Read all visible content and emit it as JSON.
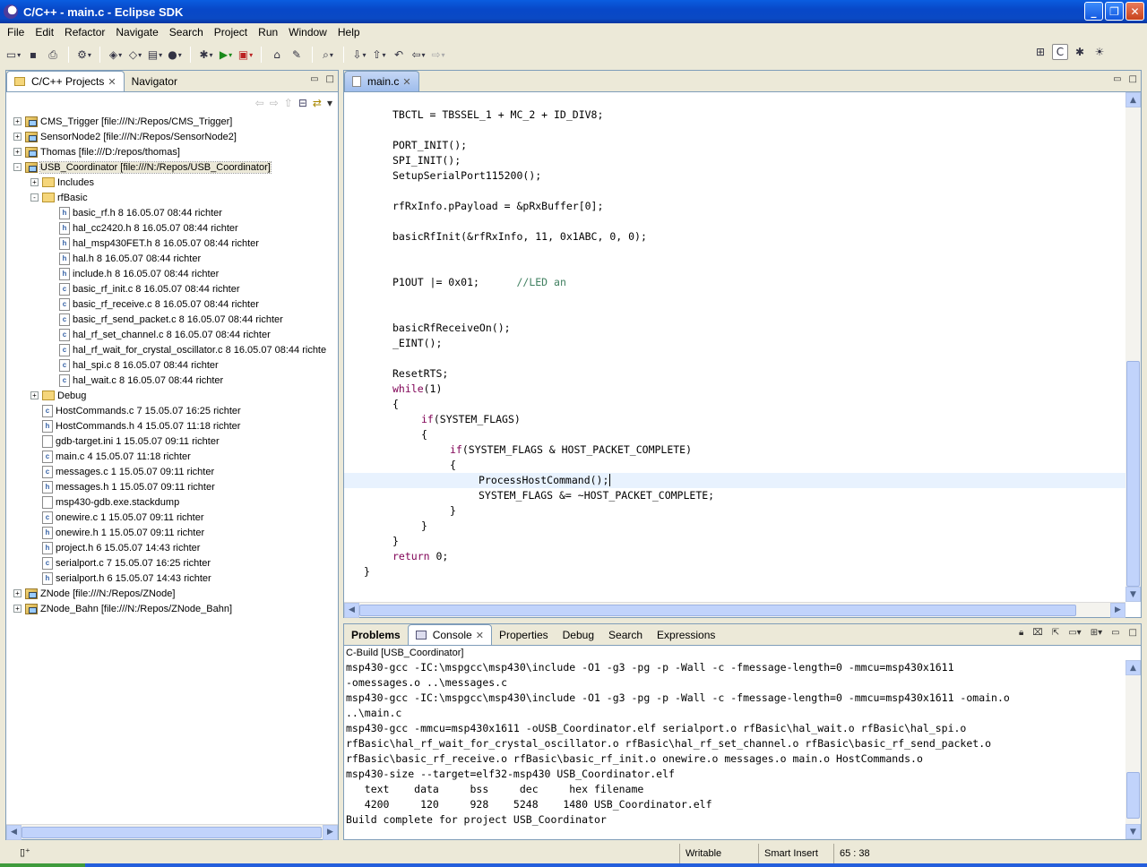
{
  "window": {
    "title": "C/C++ - main.c - Eclipse SDK"
  },
  "menu": [
    "File",
    "Edit",
    "Refactor",
    "Navigate",
    "Search",
    "Project",
    "Run",
    "Window",
    "Help"
  ],
  "left_panel": {
    "tabs": [
      {
        "label": "C/C++ Projects"
      },
      {
        "label": "Navigator"
      }
    ],
    "tree": [
      {
        "level": 0,
        "exp": "+",
        "type": "project",
        "label": "CMS_Trigger [file:///N:/Repos/CMS_Trigger]"
      },
      {
        "level": 0,
        "exp": "+",
        "type": "project",
        "label": "SensorNode2 [file:///N:/Repos/SensorNode2]"
      },
      {
        "level": 0,
        "exp": "+",
        "type": "project",
        "label": "Thomas [file:///D:/repos/thomas]"
      },
      {
        "level": 0,
        "exp": "-",
        "type": "project",
        "label": "USB_Coordinator [file:///N:/Repos/USB_Coordinator]",
        "selected": true
      },
      {
        "level": 1,
        "exp": "+",
        "type": "folder",
        "label": "Includes"
      },
      {
        "level": 1,
        "exp": "-",
        "type": "folder",
        "label": "rfBasic"
      },
      {
        "level": 2,
        "exp": "",
        "type": "file-h",
        "label": "basic_rf.h 8  16.05.07 08:44  richter"
      },
      {
        "level": 2,
        "exp": "",
        "type": "file-h",
        "label": "hal_cc2420.h 8  16.05.07 08:44  richter"
      },
      {
        "level": 2,
        "exp": "",
        "type": "file-h",
        "label": "hal_msp430FET.h 8  16.05.07 08:44  richter"
      },
      {
        "level": 2,
        "exp": "",
        "type": "file-h",
        "label": "hal.h 8  16.05.07 08:44  richter"
      },
      {
        "level": 2,
        "exp": "",
        "type": "file-h",
        "label": "include.h 8  16.05.07 08:44  richter"
      },
      {
        "level": 2,
        "exp": "",
        "type": "file-c",
        "label": "basic_rf_init.c 8  16.05.07 08:44  richter"
      },
      {
        "level": 2,
        "exp": "",
        "type": "file-c",
        "label": "basic_rf_receive.c 8  16.05.07 08:44  richter"
      },
      {
        "level": 2,
        "exp": "",
        "type": "file-c",
        "label": "basic_rf_send_packet.c 8  16.05.07 08:44  richter"
      },
      {
        "level": 2,
        "exp": "",
        "type": "file-c",
        "label": "hal_rf_set_channel.c 8  16.05.07 08:44  richter"
      },
      {
        "level": 2,
        "exp": "",
        "type": "file-c",
        "label": "hal_rf_wait_for_crystal_oscillator.c 8  16.05.07 08:44  richte"
      },
      {
        "level": 2,
        "exp": "",
        "type": "file-c",
        "label": "hal_spi.c 8  16.05.07 08:44  richter"
      },
      {
        "level": 2,
        "exp": "",
        "type": "file-c",
        "label": "hal_wait.c 8  16.05.07 08:44  richter"
      },
      {
        "level": 1,
        "exp": "+",
        "type": "folder",
        "label": "Debug"
      },
      {
        "level": 1,
        "exp": "",
        "type": "file-c",
        "label": "HostCommands.c 7  15.05.07 16:25  richter"
      },
      {
        "level": 1,
        "exp": "",
        "type": "file-h",
        "label": "HostCommands.h 4  15.05.07 11:18  richter"
      },
      {
        "level": 1,
        "exp": "",
        "type": "file-other",
        "label": "gdb-target.ini 1  15.05.07 09:11  richter"
      },
      {
        "level": 1,
        "exp": "",
        "type": "file-c",
        "label": "main.c 4  15.05.07 11:18  richter"
      },
      {
        "level": 1,
        "exp": "",
        "type": "file-c",
        "label": "messages.c 1  15.05.07 09:11  richter"
      },
      {
        "level": 1,
        "exp": "",
        "type": "file-h",
        "label": "messages.h 1  15.05.07 09:11  richter"
      },
      {
        "level": 1,
        "exp": "",
        "type": "file-other",
        "label": "msp430-gdb.exe.stackdump"
      },
      {
        "level": 1,
        "exp": "",
        "type": "file-c",
        "label": "onewire.c 1  15.05.07 09:11  richter"
      },
      {
        "level": 1,
        "exp": "",
        "type": "file-h",
        "label": "onewire.h 1  15.05.07 09:11  richter"
      },
      {
        "level": 1,
        "exp": "",
        "type": "file-h",
        "label": "project.h 6  15.05.07 14:43  richter"
      },
      {
        "level": 1,
        "exp": "",
        "type": "file-c",
        "label": "serialport.c 7  15.05.07 16:25  richter"
      },
      {
        "level": 1,
        "exp": "",
        "type": "file-h",
        "label": "serialport.h 6  15.05.07 14:43  richter"
      },
      {
        "level": 0,
        "exp": "+",
        "type": "project",
        "label": "ZNode [file:///N:/Repos/ZNode]"
      },
      {
        "level": 0,
        "exp": "+",
        "type": "project",
        "label": "ZNode_Bahn [file:///N:/Repos/ZNode_Bahn]"
      }
    ]
  },
  "editor": {
    "tab": "main.c",
    "code": [
      {
        "indent": 0,
        "parts": []
      },
      {
        "indent": 1,
        "parts": [
          [
            "",
            "TBCTL = TBSSEL_1 + MC_2 + ID_DIV8;"
          ]
        ]
      },
      {
        "indent": 0,
        "parts": []
      },
      {
        "indent": 1,
        "parts": [
          [
            "",
            "PORT_INIT();"
          ]
        ]
      },
      {
        "indent": 1,
        "parts": [
          [
            "",
            "SPI_INIT();"
          ]
        ]
      },
      {
        "indent": 1,
        "parts": [
          [
            "",
            "SetupSerialPort115200();"
          ]
        ]
      },
      {
        "indent": 0,
        "parts": []
      },
      {
        "indent": 1,
        "parts": [
          [
            "",
            "rfRxInfo.pPayload = &pRxBuffer[0];"
          ]
        ]
      },
      {
        "indent": 0,
        "parts": []
      },
      {
        "indent": 1,
        "parts": [
          [
            "",
            "basicRfInit(&rfRxInfo, 11, 0x1ABC, 0, 0);"
          ]
        ]
      },
      {
        "indent": 0,
        "parts": []
      },
      {
        "indent": 0,
        "parts": []
      },
      {
        "indent": 1,
        "parts": [
          [
            "",
            "P1OUT |= 0x01;      "
          ],
          [
            "cm",
            "//LED an"
          ]
        ]
      },
      {
        "indent": 0,
        "parts": []
      },
      {
        "indent": 0,
        "parts": []
      },
      {
        "indent": 1,
        "parts": [
          [
            "",
            "basicRfReceiveOn();"
          ]
        ]
      },
      {
        "indent": 1,
        "parts": [
          [
            "",
            "_EINT();"
          ]
        ]
      },
      {
        "indent": 0,
        "parts": []
      },
      {
        "indent": 1,
        "parts": [
          [
            "",
            "ResetRTS;"
          ]
        ]
      },
      {
        "indent": 1,
        "parts": [
          [
            "kw",
            "while"
          ],
          [
            "",
            "(1)"
          ]
        ]
      },
      {
        "indent": 1,
        "parts": [
          [
            "",
            "{"
          ]
        ]
      },
      {
        "indent": 2,
        "parts": [
          [
            "kw",
            "if"
          ],
          [
            "",
            "(SYSTEM_FLAGS)"
          ]
        ]
      },
      {
        "indent": 2,
        "parts": [
          [
            "",
            "{"
          ]
        ]
      },
      {
        "indent": 3,
        "parts": [
          [
            "kw",
            "if"
          ],
          [
            "",
            "(SYSTEM_FLAGS & HOST_PACKET_COMPLETE)"
          ]
        ]
      },
      {
        "indent": 3,
        "parts": [
          [
            "",
            "{"
          ]
        ]
      },
      {
        "indent": 4,
        "parts": [
          [
            "",
            "ProcessHostCommand();"
          ]
        ],
        "current": true
      },
      {
        "indent": 4,
        "parts": [
          [
            "",
            "SYSTEM_FLAGS &= ~HOST_PACKET_COMPLETE;"
          ]
        ]
      },
      {
        "indent": 3,
        "parts": [
          [
            "",
            "}"
          ]
        ]
      },
      {
        "indent": 2,
        "parts": [
          [
            "",
            "}"
          ]
        ]
      },
      {
        "indent": 1,
        "parts": [
          [
            "",
            "}"
          ]
        ]
      },
      {
        "indent": 1,
        "parts": [
          [
            "kw",
            "return"
          ],
          [
            "",
            " 0;"
          ]
        ]
      },
      {
        "indent": 0,
        "parts": [
          [
            "",
            "}"
          ]
        ]
      }
    ]
  },
  "console": {
    "tabs": [
      {
        "label": "Problems",
        "bold": true
      },
      {
        "label": "Console",
        "active": true
      },
      {
        "label": "Properties"
      },
      {
        "label": "Debug"
      },
      {
        "label": "Search"
      },
      {
        "label": "Expressions"
      }
    ],
    "header": "C-Build [USB_Coordinator]",
    "lines": [
      "msp430-gcc -IC:\\mspgcc\\msp430\\include -O1 -g3 -pg -p -Wall -c -fmessage-length=0 -mmcu=msp430x1611",
      "-omessages.o ..\\messages.c",
      "msp430-gcc -IC:\\mspgcc\\msp430\\include -O1 -g3 -pg -p -Wall -c -fmessage-length=0 -mmcu=msp430x1611 -omain.o",
      "..\\main.c",
      "msp430-gcc -mmcu=msp430x1611 -oUSB_Coordinator.elf serialport.o rfBasic\\hal_wait.o rfBasic\\hal_spi.o",
      "rfBasic\\hal_rf_wait_for_crystal_oscillator.o rfBasic\\hal_rf_set_channel.o rfBasic\\basic_rf_send_packet.o",
      "rfBasic\\basic_rf_receive.o rfBasic\\basic_rf_init.o onewire.o messages.o main.o HostCommands.o",
      "msp430-size --target=elf32-msp430 USB_Coordinator.elf",
      "   text    data     bss     dec     hex filename",
      "   4200     120     928    5248    1480 USB_Coordinator.elf",
      "Build complete for project USB_Coordinator"
    ]
  },
  "status": {
    "mode1": "Writable",
    "mode2": "Smart Insert",
    "position": "65 : 38"
  }
}
